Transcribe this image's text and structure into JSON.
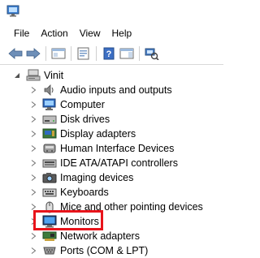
{
  "menu": {
    "file": "File",
    "action": "Action",
    "view": "View",
    "help": "Help"
  },
  "toolbar": {
    "icons": [
      "back-arrow-icon",
      "forward-arrow-icon",
      "show-hide-console-tree-icon",
      "properties-icon",
      "help-icon",
      "action-pane-icon",
      "scan-hardware-icon"
    ]
  },
  "tree": {
    "root": "Vinit",
    "items": [
      "Audio inputs and outputs",
      "Computer",
      "Disk drives",
      "Display adapters",
      "Human Interface Devices",
      "IDE ATA/ATAPI controllers",
      "Imaging devices",
      "Keyboards",
      "Mice and other pointing devices",
      "Monitors",
      "Network adapters",
      "Ports (COM & LPT)"
    ]
  },
  "colors": {
    "highlight_border": "#e8141b",
    "window_bg": "#ffffff"
  }
}
